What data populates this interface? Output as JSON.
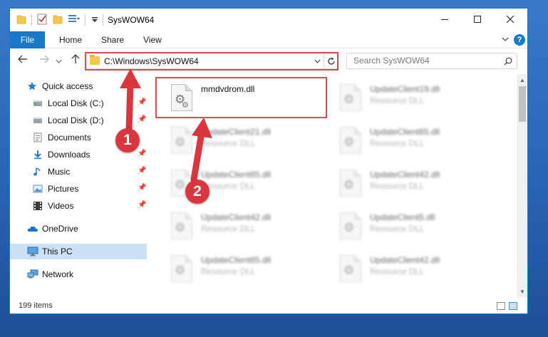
{
  "window": {
    "title": "SysWOW64",
    "controls": [
      "minimize",
      "maximize",
      "close"
    ]
  },
  "ribbon": {
    "file_tab": "File",
    "tabs": [
      "Home",
      "Share",
      "View"
    ]
  },
  "navigation": {
    "address": "C:\\Windows\\SysWOW64",
    "search_placeholder": "Search SysWOW64"
  },
  "sidebar": {
    "items": [
      {
        "label": "Quick access",
        "icon": "star-icon",
        "pinned": false
      },
      {
        "label": "Local Disk (C:)",
        "icon": "drive-icon",
        "pinned": true
      },
      {
        "label": "Local Disk (D:)",
        "icon": "drive-icon",
        "pinned": true
      },
      {
        "label": "Documents",
        "icon": "documents-icon",
        "pinned": false
      },
      {
        "label": "Downloads",
        "icon": "download-icon",
        "pinned": true
      },
      {
        "label": "Music",
        "icon": "music-icon",
        "pinned": true
      },
      {
        "label": "Pictures",
        "icon": "pictures-icon",
        "pinned": true
      },
      {
        "label": "Videos",
        "icon": "videos-icon",
        "pinned": true
      },
      {
        "label": "OneDrive",
        "icon": "cloud-icon",
        "pinned": false
      },
      {
        "label": "This PC",
        "icon": "computer-icon",
        "pinned": false,
        "selected": true
      },
      {
        "label": "Network",
        "icon": "network-icon",
        "pinned": false
      }
    ]
  },
  "files": {
    "left": [
      {
        "name": "mmdvdrom.dll",
        "type": ""
      },
      {
        "name": "UpdateClient21.dll",
        "type": "Resource DLL"
      },
      {
        "name": "UpdateClient65.dll",
        "type": "Resource DLL"
      },
      {
        "name": "UpdateClient42.dll",
        "type": "Resource DLL"
      },
      {
        "name": "UpdateClient65.dll",
        "type": "Resource DLL"
      }
    ],
    "right": [
      {
        "name": "UpdateClient19.dll",
        "type": "Resource DLL"
      },
      {
        "name": "UpdateClient65.dll",
        "type": "Resource DLL"
      },
      {
        "name": "UpdateClient42.dll",
        "type": "Resource DLL"
      },
      {
        "name": "UpdateClient5.dll",
        "type": "Resource DLL"
      },
      {
        "name": "UpdateClient42.dll",
        "type": "Resource DLL"
      }
    ]
  },
  "status": {
    "item_count": "199 items"
  },
  "annotations": {
    "step1": "1",
    "step2": "2",
    "color": "#e34850"
  }
}
